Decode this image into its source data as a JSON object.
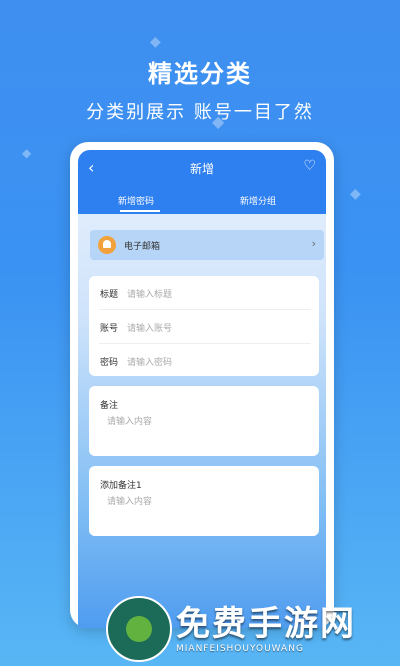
{
  "promo": {
    "title": "精选分类",
    "subtitle": "分类别展示 账号一目了然"
  },
  "app": {
    "title": "新增",
    "back_icon": "chevron-left-icon",
    "favorite_icon": "heart-icon",
    "tabs": [
      {
        "label": "新增密码",
        "active": true
      },
      {
        "label": "新增分组",
        "active": false
      }
    ],
    "category": {
      "label": "电子邮箱",
      "icon": "mail-icon",
      "chevron_icon": "chevron-right-icon"
    },
    "fields": [
      {
        "label": "标题",
        "placeholder": "请输入标题"
      },
      {
        "label": "账号",
        "placeholder": "请输入账号"
      },
      {
        "label": "密码",
        "placeholder": "请输入密码"
      }
    ],
    "notes": [
      {
        "label": "备注",
        "placeholder": "请输入内容"
      },
      {
        "label": "添加备注1",
        "placeholder": "请输入内容"
      }
    ]
  },
  "watermark": {
    "text": "免费手游网",
    "subtext": "MIANFEISHOUYOUWANG"
  },
  "colors": {
    "background": "#3f8ff0",
    "header": "#2e7ff0",
    "category_icon": "#f2a23c"
  }
}
